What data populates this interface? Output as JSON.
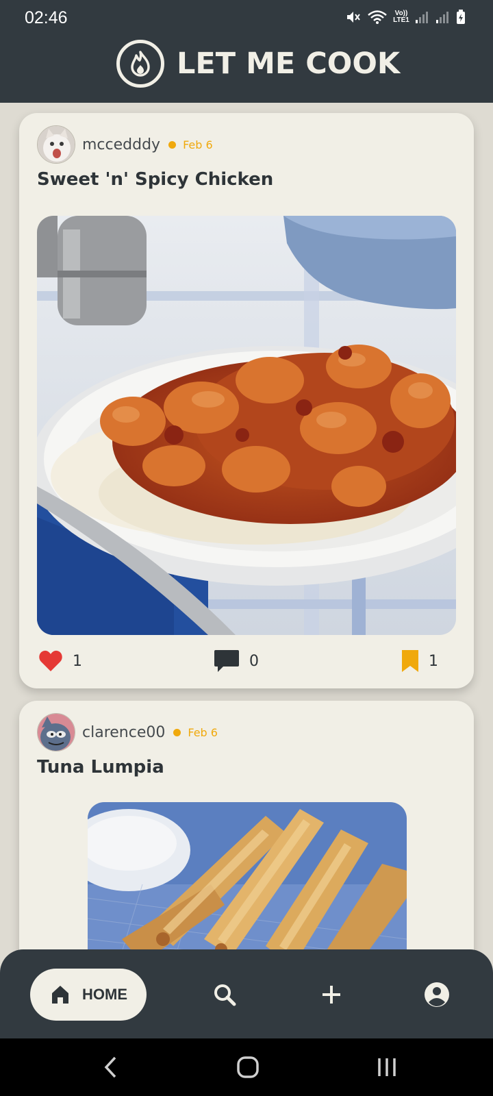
{
  "status_bar": {
    "time": "02:46",
    "network_label": "Vo)) LTE1"
  },
  "header": {
    "title": "LET ME COOK",
    "logo_icon": "flame-icon"
  },
  "colors": {
    "header_bg": "#323a40",
    "card_bg": "#f1efe6",
    "accent": "#f0a90d",
    "like": "#e53935",
    "bookmark": "#f0a90d"
  },
  "posts": [
    {
      "username": "mccedddy",
      "date": "Feb 6",
      "title": "Sweet 'n' Spicy Chicken",
      "likes": "1",
      "comments": "0",
      "saves": "1"
    },
    {
      "username": "clarence00",
      "date": "Feb 6",
      "title": "Tuna Lumpia"
    }
  ],
  "bottom_nav": {
    "home_label": "HOME",
    "items": [
      "home-icon",
      "search-icon",
      "add-icon",
      "profile-icon"
    ]
  }
}
